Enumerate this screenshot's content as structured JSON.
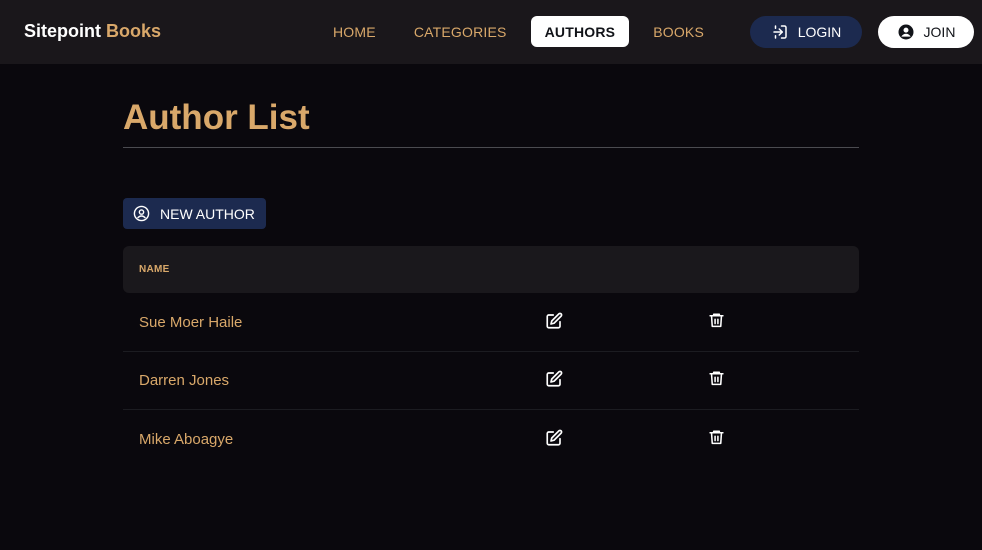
{
  "brand": {
    "name_main": "Sitepoint",
    "name_accent": "Books"
  },
  "nav": {
    "links": [
      {
        "label": "HOME",
        "active": false
      },
      {
        "label": "CATEGORIES",
        "active": false
      },
      {
        "label": "AUTHORS",
        "active": true
      },
      {
        "label": "BOOKS",
        "active": false
      }
    ],
    "login_label": "LOGIN",
    "join_label": "JOIN"
  },
  "page": {
    "title": "Author List",
    "new_button_label": "NEW AUTHOR"
  },
  "table": {
    "columns": [
      "NAME"
    ],
    "rows": [
      {
        "name": "Sue Moer Haile",
        "edit_icon": "edit-icon",
        "delete_icon": "trash-icon"
      },
      {
        "name": "Darren Jones",
        "edit_icon": "edit-icon",
        "delete_icon": "trash-icon"
      },
      {
        "name": "Mike Aboagye",
        "edit_icon": "edit-icon",
        "delete_icon": "trash-icon"
      }
    ]
  },
  "colors": {
    "accent": "#d9a86a",
    "background": "#0a080d",
    "navbar": "#1a171b",
    "button_primary": "#1c2a4f",
    "active_tab": "#ffffff"
  },
  "icons": {
    "login": "login-icon",
    "join": "user-circle-icon",
    "new_author": "user-circle-outline-icon",
    "edit": "edit-icon",
    "delete": "trash-icon"
  }
}
